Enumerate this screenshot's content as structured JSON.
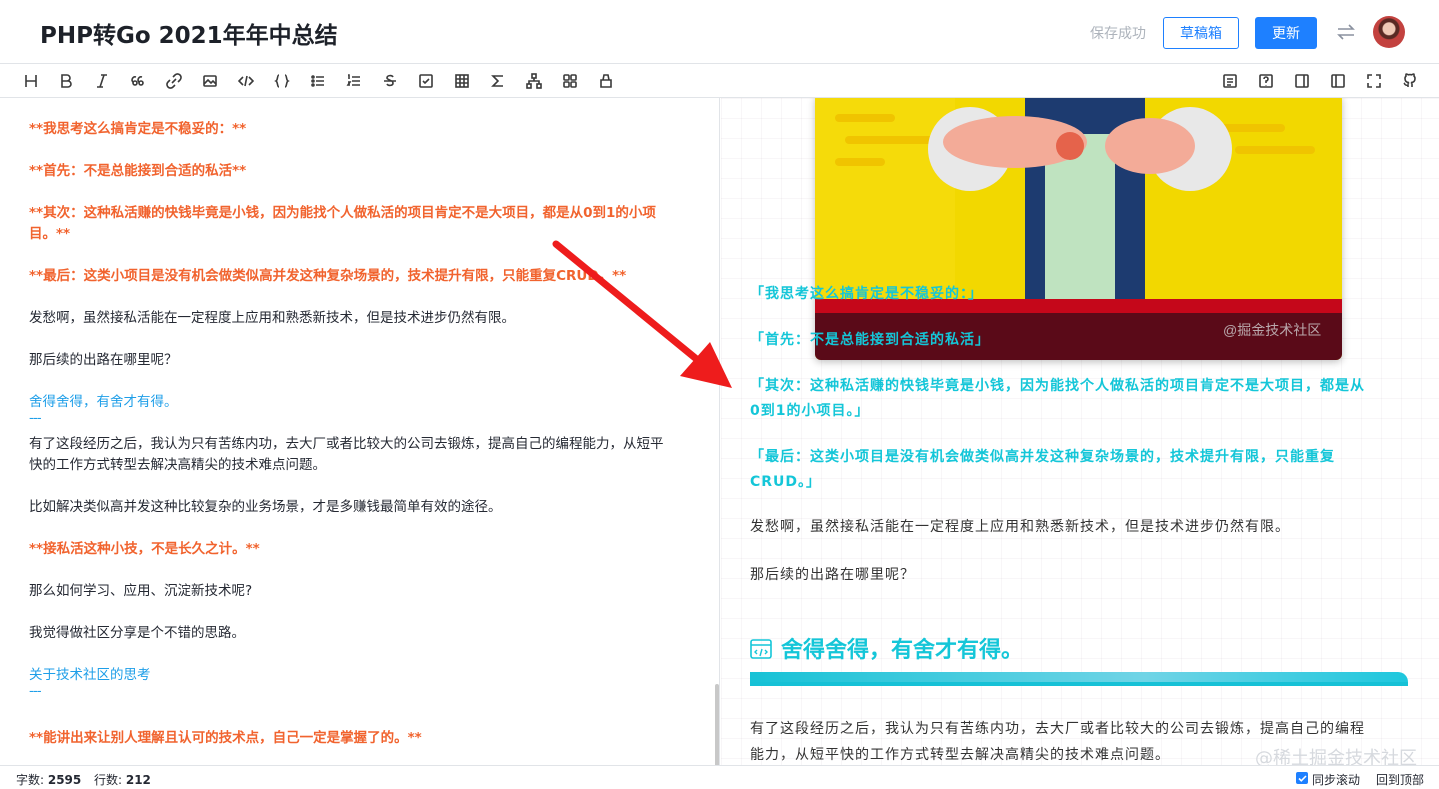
{
  "header": {
    "title": "PHP转Go 2021年年中总结",
    "save_status": "保存成功",
    "draft_label": "草稿箱",
    "update_label": "更新"
  },
  "toolbar": {
    "left_icons": [
      "heading-icon",
      "bold-icon",
      "italic-icon",
      "quote-icon",
      "link-icon",
      "image-icon",
      "code-icon",
      "code-block-icon",
      "unordered-list-icon",
      "ordered-list-icon",
      "strikethrough-icon",
      "task-list-icon",
      "table-icon",
      "formula-icon",
      "diagram-icon",
      "grid-icon",
      "theme-icon"
    ],
    "right_icons": [
      "outline-icon",
      "help-icon",
      "preview-only-icon",
      "editor-only-icon",
      "fullscreen-icon",
      "github-icon"
    ]
  },
  "editor": {
    "lines": [
      {
        "text": "**我思考这么搞肯定是不稳妥的：**",
        "style": "strong"
      },
      {
        "text": "**首先：不是总能接到合适的私活**",
        "style": "strong"
      },
      {
        "text": "**其次：这种私活赚的快钱毕竟是小钱，因为能找个人做私活的项目肯定不是大项目，都是从0到1的小项",
        "style": "strong"
      },
      {
        "text": "目。**",
        "style": "strong"
      },
      {
        "text": "**最后：这类小项目是没有机会做类似高并发这种复杂场景的，技术提升有限，只能重复CRUD。**",
        "style": "strong"
      },
      {
        "text": "发愁啊，虽然接私活能在一定程度上应用和熟悉新技术，但是技术进步仍然有限。",
        "style": "normal"
      },
      {
        "text": "那后续的出路在哪里呢？",
        "style": "normal"
      },
      {
        "text": "舍得舍得，有舍才有得。",
        "style": "head"
      },
      {
        "text": "---",
        "style": "hr"
      },
      {
        "text": "有了这段经历之后，我认为只有苦练内功，去大厂或者比较大的公司去锻炼，提高自己的编程能力，从短平",
        "style": "normal"
      },
      {
        "text": "快的工作方式转型去解决高精尖的技术难点问题。",
        "style": "normal"
      },
      {
        "text": "比如解决类似高并发这种比较复杂的业务场景，才是多赚钱最简单有效的途径。",
        "style": "normal"
      },
      {
        "text": "**接私活这种小技，不是长久之计。**",
        "style": "strong"
      },
      {
        "text": "那么如何学习、应用、沉淀新技术呢?",
        "style": "normal"
      },
      {
        "text": "我觉得做社区分享是个不错的思路。",
        "style": "normal"
      },
      {
        "text": "关于技术社区的思考",
        "style": "head"
      },
      {
        "text": "---",
        "style": "hr"
      },
      {
        "text": "**能讲出来让别人理解且认可的技术点，自己一定是掌握了的。**",
        "style": "strong"
      }
    ]
  },
  "preview": {
    "image_watermark": "@掘金技术社区",
    "cyan_lines": [
      "「我思考这么搞肯定是不稳妥的：」",
      "「首先：不是总能接到合适的私活」",
      "「其次：这种私活赚的快钱毕竟是小钱，因为能找个人做私活的项目肯定不是大项目，都是从",
      "0到1的小项目。」",
      "「最后：这类小项目是没有机会做类似高并发这种复杂场景的，技术提升有限，只能重复",
      "CRUD。」"
    ],
    "paragraphs": [
      "发愁啊，虽然接私活能在一定程度上应用和熟悉新技术，但是技术进步仍然有限。",
      "那后续的出路在哪里呢？"
    ],
    "heading": "舍得舍得，有舍才有得。",
    "after_heading": [
      "有了这段经历之后，我认为只有苦练内功，去大厂或者比较大的公司去锻炼，提高自己的编程",
      "能力，从短平快的工作方式转型去解决高精尖的技术难点问题。"
    ]
  },
  "watermark": "@稀土掘金技术社区",
  "statusbar": {
    "words_label": "字数: ",
    "words": "2595",
    "lines_label": "行数: ",
    "lines": "212",
    "sync_label": "同步滚动",
    "back_top_label": "回到顶部"
  },
  "colors": {
    "primary": "#1e80ff",
    "markdown_strong": "#f1632e",
    "markdown_heading": "#1e9ee8",
    "preview_cyan": "#14c6d8",
    "annotation_arrow": "#ee1c1c"
  }
}
